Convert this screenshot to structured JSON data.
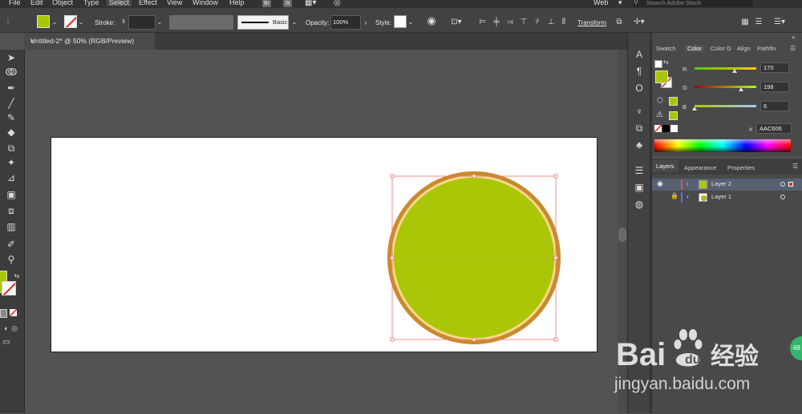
{
  "menu": [
    "File",
    "Edit",
    "Object",
    "Type",
    "Select",
    "Effect",
    "View",
    "Window",
    "Help"
  ],
  "menu_badges": [
    "Br",
    "St"
  ],
  "workspace": "Web",
  "search_placeholder": "Search Adobe Stock",
  "control_bar": {
    "stroke_label": "Stroke:",
    "brush_label": "Basic",
    "opacity_label": "Opacity:",
    "opacity_value": "100%",
    "style_label": "Style:",
    "transform_label": "Transform"
  },
  "document_tab": "Untitled-2* @ 50% (RGB/Preview)",
  "color_panel": {
    "tabs": [
      "Swatch",
      "Color",
      "Color G",
      "Align",
      "Pathfin"
    ],
    "channels": [
      {
        "label": "R",
        "value": "170",
        "fraction": 0.667
      },
      {
        "label": "G",
        "value": "198",
        "fraction": 0.776
      },
      {
        "label": "B",
        "value": "6",
        "fraction": 0.024
      }
    ],
    "hex_label": "#",
    "hex_value": "AAC606"
  },
  "layers_panel": {
    "tabs": [
      "Layers",
      "Appearance",
      "Properties"
    ],
    "layers": [
      {
        "name": "Layer 2",
        "color": "#e05050",
        "selected": true
      },
      {
        "name": "Layer 1",
        "color": "#4a7ae0",
        "selected": false
      }
    ]
  },
  "colors": {
    "fill": "#AAC606",
    "ring_outer": "#C98A2E",
    "ring_inner": "#F6D98C",
    "selection": "#f07070"
  },
  "watermark": {
    "brand": "Bai",
    "brand2": "du",
    "brand_cn": "经验",
    "url": "jingyan.baidu.com",
    "badge": "68"
  }
}
